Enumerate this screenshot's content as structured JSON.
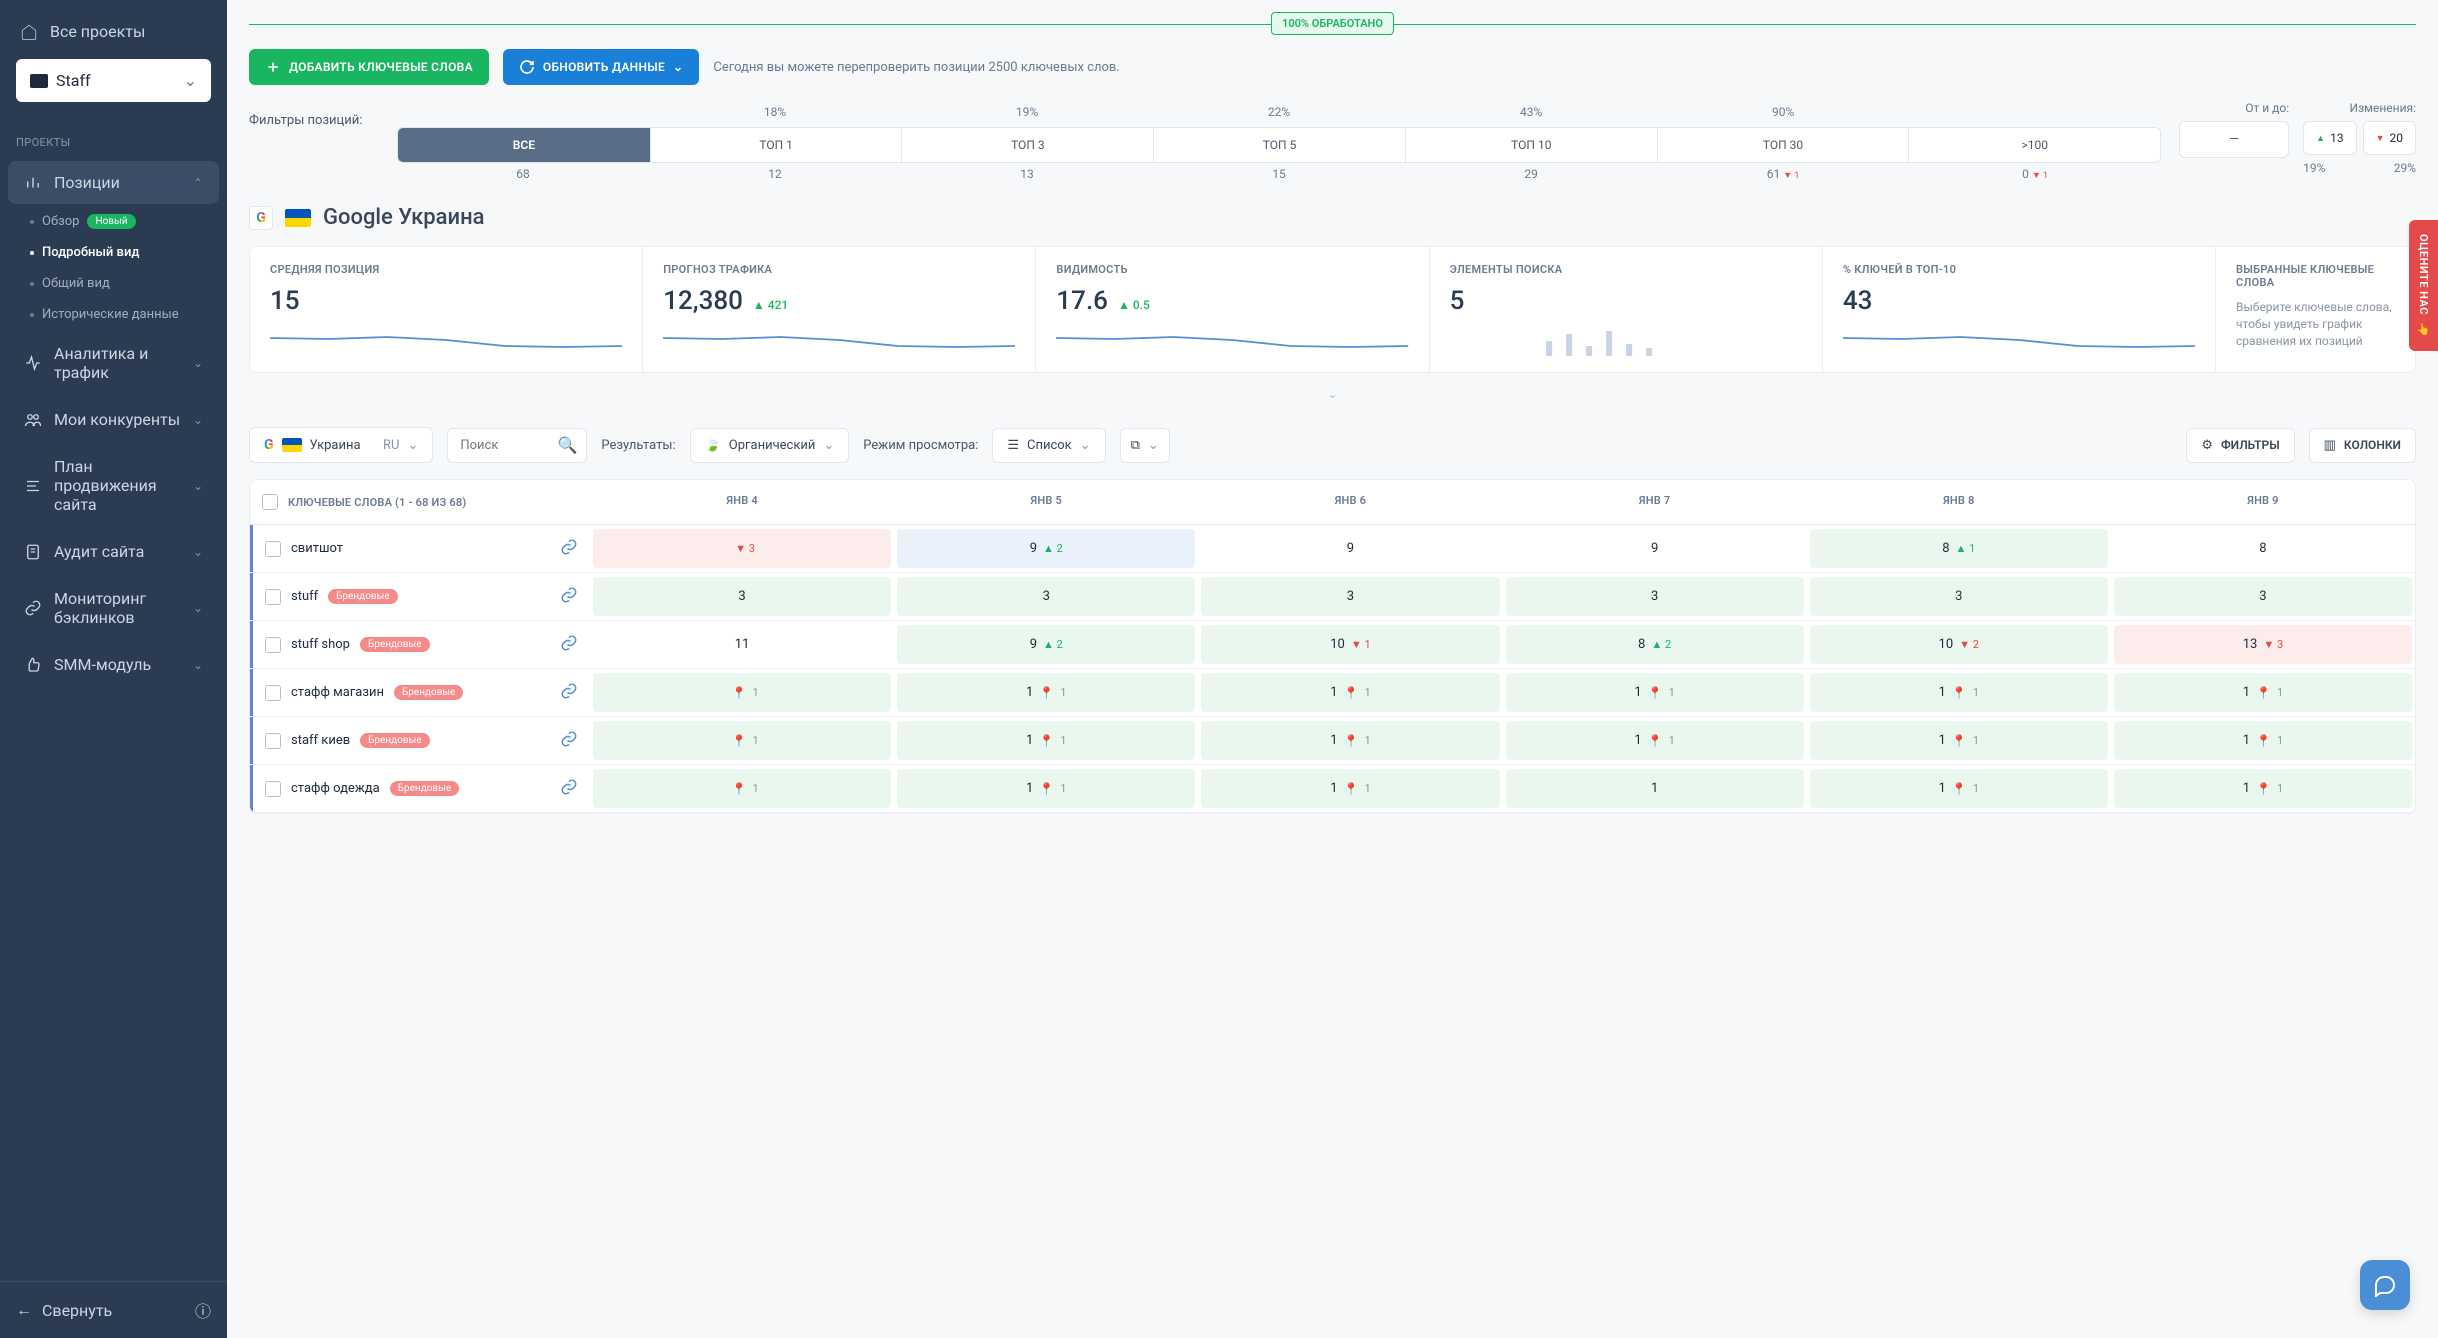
{
  "sidebar": {
    "all_projects": "Все проекты",
    "project_name": "Staff",
    "section_label": "ПРОЕКТЫ",
    "positions": "Позиции",
    "sub": {
      "overview": "Обзор",
      "new_badge": "Новый",
      "detailed": "Подробный вид",
      "general": "Общий вид",
      "historical": "Исторические данные"
    },
    "analytics": "Аналитика и трафик",
    "competitors": "Мои конкуренты",
    "plan": "План продвижения сайта",
    "audit": "Аудит сайта",
    "backlinks": "Мониторинг бэклинков",
    "smm": "SMM-модуль",
    "collapse": "Свернуть"
  },
  "progress_badge": "100% ОБРАБОТАНО",
  "toolbar": {
    "add": "ДОБАВИТЬ КЛЮЧЕВЫЕ СЛОВА",
    "refresh": "ОБНОВИТЬ ДАННЫЕ",
    "tip": "Сегодня вы можете перепроверить позиции 2500 ключевых слов."
  },
  "filters": {
    "label": "Фильтры позиций:",
    "pct": [
      "",
      "18%",
      "19%",
      "22%",
      "43%",
      "90%"
    ],
    "cells": [
      "ВСЕ",
      "ТОП 1",
      "ТОП 3",
      "ТОП 5",
      "ТОП 10",
      "ТОП 30",
      ">100"
    ],
    "count": [
      "68",
      "12",
      "13",
      "15",
      "29",
      "61",
      "0"
    ],
    "count_delta": [
      "",
      "",
      "",
      "",
      "",
      "▼ 1",
      "▼ 1"
    ],
    "range_label": "От и до:",
    "range_value": "—",
    "changes_label": "Изменения:",
    "changes_up": "13",
    "changes_down": "20",
    "changes_pct_up": "19%",
    "changes_pct_down": "29%"
  },
  "se": {
    "title": "Google Украина"
  },
  "stats": [
    {
      "label": "СРЕДНЯЯ ПОЗИЦИЯ",
      "value": "15",
      "delta": ""
    },
    {
      "label": "ПРОГНОЗ ТРАФИКА",
      "value": "12,380",
      "delta": "▲ 421"
    },
    {
      "label": "ВИДИМОСТЬ",
      "value": "17.6",
      "delta": "▲ 0.5"
    },
    {
      "label": "ЭЛЕМЕНТЫ ПОИСКА",
      "value": "5",
      "delta": ""
    },
    {
      "label": "% КЛЮЧЕЙ В ТОП-10",
      "value": "43",
      "delta": ""
    }
  ],
  "selected_stat": {
    "label": "ВЫБРАННЫЕ КЛЮЧЕВЫЕ СЛОВА",
    "hint": "Выберите ключевые слова, чтобы увидеть график сравнения их позиций"
  },
  "controls": {
    "country": "Украина",
    "lang": "RU",
    "search_placeholder": "Поиск",
    "results": "Результаты:",
    "organic": "Органический",
    "view_mode": "Режим просмотра:",
    "list": "Список",
    "filters_btn": "ФИЛЬТРЫ",
    "columns_btn": "КОЛОНКИ"
  },
  "table": {
    "keywords_header": "КЛЮЧЕВЫЕ СЛОВА (1 - 68 ИЗ 68)",
    "dates": [
      "ЯНВ 4",
      "ЯНВ 5",
      "ЯНВ 6",
      "ЯНВ 7",
      "ЯНВ 8",
      "ЯНВ 9"
    ],
    "rows": [
      {
        "kw": "свитшот",
        "tag": "",
        "cells": [
          {
            "v": "",
            "d": "▼ 3",
            "c": "red",
            "pin": false
          },
          {
            "v": "9",
            "d": "▲ 2",
            "c": "blue",
            "pin": false
          },
          {
            "v": "9",
            "d": "",
            "c": "",
            "pin": false
          },
          {
            "v": "9",
            "d": "",
            "c": "",
            "pin": false
          },
          {
            "v": "8",
            "d": "▲ 1",
            "c": "green",
            "pin": false
          },
          {
            "v": "8",
            "d": "",
            "c": "",
            "pin": false
          }
        ]
      },
      {
        "kw": "stuff",
        "tag": "Брендовые",
        "cells": [
          {
            "v": "3",
            "d": "",
            "c": "green",
            "pin": false
          },
          {
            "v": "3",
            "d": "",
            "c": "green",
            "pin": false
          },
          {
            "v": "3",
            "d": "",
            "c": "green",
            "pin": false
          },
          {
            "v": "3",
            "d": "",
            "c": "green",
            "pin": false
          },
          {
            "v": "3",
            "d": "",
            "c": "green",
            "pin": false
          },
          {
            "v": "3",
            "d": "",
            "c": "green",
            "pin": false
          }
        ]
      },
      {
        "kw": "stuff shop",
        "tag": "Брендовые",
        "cells": [
          {
            "v": "11",
            "d": "",
            "c": "",
            "pin": false
          },
          {
            "v": "9",
            "d": "▲ 2",
            "c": "green",
            "pin": false
          },
          {
            "v": "10",
            "d": "▼ 1",
            "c": "green",
            "pin": false
          },
          {
            "v": "8",
            "d": "▲ 2",
            "c": "green",
            "pin": false
          },
          {
            "v": "10",
            "d": "▼ 2",
            "c": "green",
            "pin": false
          },
          {
            "v": "13",
            "d": "▼ 3",
            "c": "red",
            "pin": false
          }
        ]
      },
      {
        "kw": "стафф магазин",
        "tag": "Брендовые",
        "cells": [
          {
            "v": "",
            "d": "1",
            "c": "green",
            "pin": true
          },
          {
            "v": "1",
            "d": "1",
            "c": "green",
            "pin": true
          },
          {
            "v": "1",
            "d": "1",
            "c": "green",
            "pin": true
          },
          {
            "v": "1",
            "d": "1",
            "c": "green",
            "pin": true
          },
          {
            "v": "1",
            "d": "1",
            "c": "green",
            "pin": true
          },
          {
            "v": "1",
            "d": "1",
            "c": "green",
            "pin": true
          }
        ]
      },
      {
        "kw": "staff киев",
        "tag": "Брендовые",
        "cells": [
          {
            "v": "",
            "d": "1",
            "c": "green",
            "pin": true
          },
          {
            "v": "1",
            "d": "1",
            "c": "green",
            "pin": true
          },
          {
            "v": "1",
            "d": "1",
            "c": "green",
            "pin": true
          },
          {
            "v": "1",
            "d": "1",
            "c": "green",
            "pin": true
          },
          {
            "v": "1",
            "d": "1",
            "c": "green",
            "pin": true
          },
          {
            "v": "1",
            "d": "1",
            "c": "green",
            "pin": true
          }
        ]
      },
      {
        "kw": "стафф одежда",
        "tag": "Брендовые",
        "cells": [
          {
            "v": "",
            "d": "1",
            "c": "green",
            "pin": true
          },
          {
            "v": "1",
            "d": "1",
            "c": "green",
            "pin": true
          },
          {
            "v": "1",
            "d": "1",
            "c": "green",
            "pin": true
          },
          {
            "v": "1",
            "d": "",
            "c": "green",
            "pin": false
          },
          {
            "v": "1",
            "d": "1",
            "c": "green",
            "pin": true
          },
          {
            "v": "1",
            "d": "1",
            "c": "green",
            "pin": true
          }
        ]
      }
    ]
  },
  "feedback": "ОЦЕНИТЕ НАС"
}
